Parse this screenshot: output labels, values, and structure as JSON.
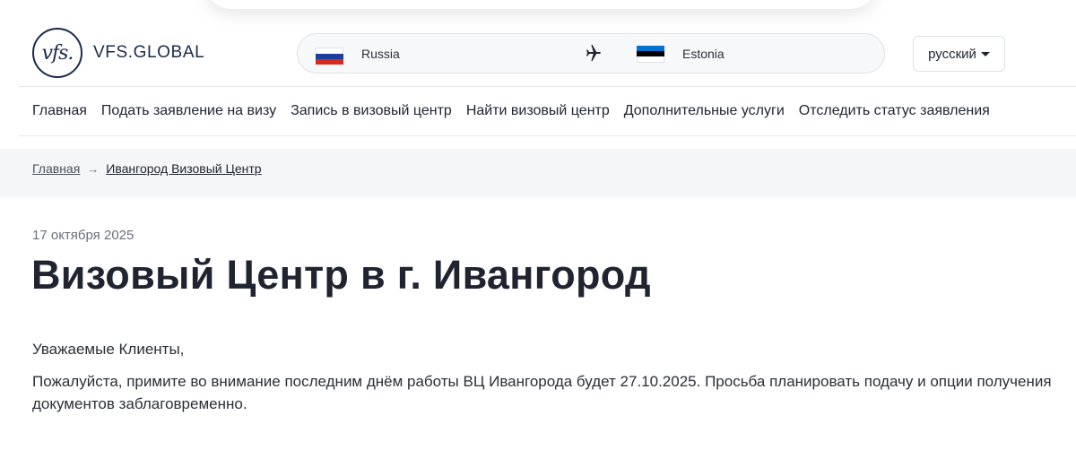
{
  "header": {
    "logo_mark": "vfs.",
    "logo_text": "VFS.GLOBAL",
    "route": {
      "from_country": "Russia",
      "to_country": "Estonia"
    },
    "language": "русский"
  },
  "nav": {
    "items": [
      {
        "label": "Главная"
      },
      {
        "label": "Подать заявление на визу"
      },
      {
        "label": "Запись в визовый центр"
      },
      {
        "label": "Найти визовый центр"
      },
      {
        "label": "Дополнительные услуги"
      },
      {
        "label": "Отследить статус заявления"
      }
    ]
  },
  "breadcrumb": {
    "home": "Главная",
    "separator": "→",
    "current": "Ивангород Визовый Центр"
  },
  "article": {
    "date": "17 октября 2025",
    "title": "Визовый Центр в г. Ивангород",
    "greeting": "Уважаемые Клиенты,",
    "body": "Пожалуйста, примите во внимание последним днём работы ВЦ Ивангорода будет 27.10.2025. Просьба планировать подачу и опции получения документов заблаговременно."
  },
  "colors": {
    "brand_navy": "#1b2a4a",
    "flag_ru": [
      "#ffffff",
      "#1c3f9e",
      "#d52b1e"
    ],
    "flag_ee": [
      "#0072ce",
      "#000000",
      "#ffffff"
    ]
  },
  "icons": {
    "route_separator": "airplane-icon",
    "language_dropdown": "caret-down-icon",
    "breadcrumb_separator": "arrow-right-icon"
  }
}
